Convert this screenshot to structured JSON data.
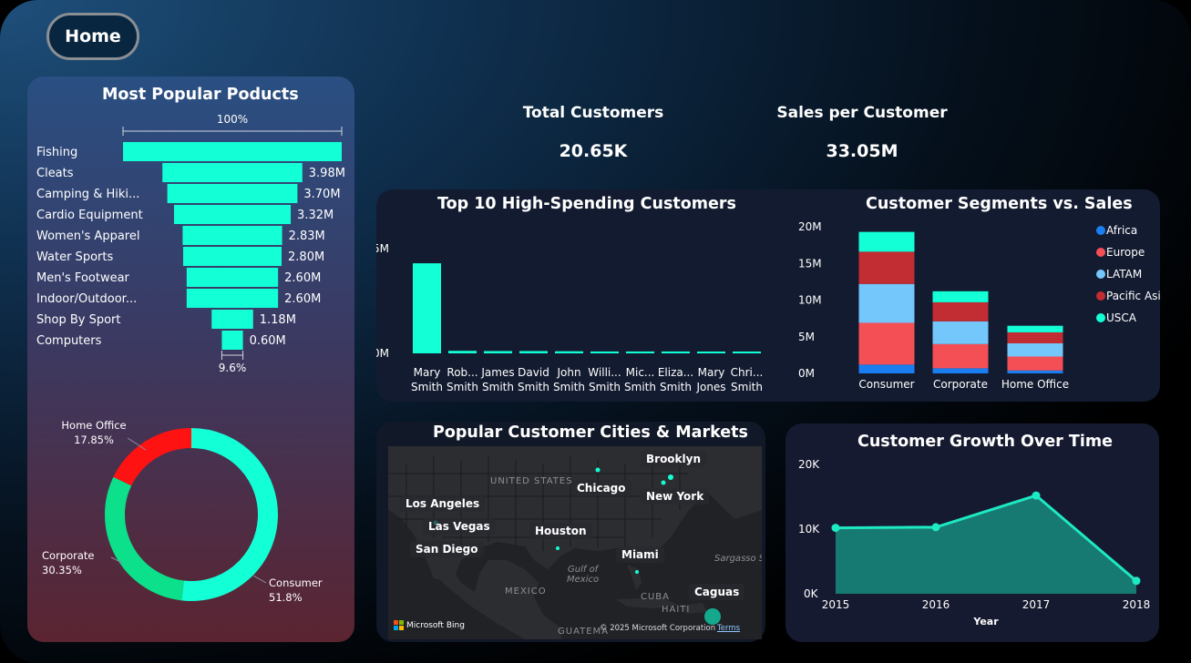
{
  "nav": {
    "home_label": "Home"
  },
  "products": {
    "title": "Most Popular Poducts",
    "top_pct": "100%",
    "bottom_pct": "9.6%",
    "items": [
      {
        "label": "Fishing",
        "value_label": "",
        "value": 6.22
      },
      {
        "label": "Cleats",
        "value_label": "3.98M",
        "value": 3.98
      },
      {
        "label": "Camping & Hiki...",
        "value_label": "3.70M",
        "value": 3.7
      },
      {
        "label": "Cardio Equipment",
        "value_label": "3.32M",
        "value": 3.32
      },
      {
        "label": "Women's Apparel",
        "value_label": "2.83M",
        "value": 2.83
      },
      {
        "label": "Water Sports",
        "value_label": "2.80M",
        "value": 2.8
      },
      {
        "label": "Men's Footwear",
        "value_label": "2.60M",
        "value": 2.6
      },
      {
        "label": "Indoor/Outdoor...",
        "value_label": "2.60M",
        "value": 2.6
      },
      {
        "label": "Shop By Sport",
        "value_label": "1.18M",
        "value": 1.18
      },
      {
        "label": "Computers",
        "value_label": "0.60M",
        "value": 0.6
      }
    ],
    "bar_color": "#13ffd6"
  },
  "donut": {
    "segments": [
      {
        "name": "Consumer",
        "pct_label": "51.8%",
        "value": 51.8,
        "color": "#13ffd6"
      },
      {
        "name": "Corporate",
        "pct_label": "30.35%",
        "value": 30.35,
        "color": "#0ce08a"
      },
      {
        "name": "Home Office",
        "pct_label": "17.85%",
        "value": 17.85,
        "color": "#ff1212"
      }
    ]
  },
  "kpis": {
    "total_customers_title": "Total Customers",
    "total_customers_value": "20.65K",
    "sales_per_customer_title": "Sales per Customer",
    "sales_per_customer_value": "33.05M"
  },
  "top_customers": {
    "title": "Top 10 High-Spending Customers",
    "y_ticks": [
      "5M",
      "0M"
    ],
    "names": [
      [
        "Mary",
        "Smith"
      ],
      [
        "Rob...",
        "Smith"
      ],
      [
        "James",
        "Smith"
      ],
      [
        "David",
        "Smith"
      ],
      [
        "John",
        "Smith"
      ],
      [
        "Willi...",
        "Smith"
      ],
      [
        "Mic...",
        "Smith"
      ],
      [
        "Eliza...",
        "Smith"
      ],
      [
        "Mary",
        "Jones"
      ],
      [
        "Chri...",
        "Smith"
      ]
    ]
  },
  "segments_chart": {
    "title": "Customer Segments vs. Sales",
    "y_ticks": [
      "20M",
      "15M",
      "10M",
      "5M",
      "0M"
    ],
    "legend": [
      {
        "name": "Africa",
        "color": "#1a7ef0"
      },
      {
        "name": "Europe",
        "color": "#f54f56"
      },
      {
        "name": "LATAM",
        "color": "#74c7fb"
      },
      {
        "name": "Pacific Asia",
        "color": "#c22c33"
      },
      {
        "name": "USCA",
        "color": "#13ffd6"
      }
    ]
  },
  "map": {
    "title": "Popular Customer Cities & Markets",
    "cities": [
      "Brooklyn",
      "Los Angeles",
      "Chicago",
      "New York",
      "Las Vegas",
      "Houston",
      "San Diego",
      "Miami",
      "Caguas"
    ],
    "geo_labels": [
      "UNITED STATES",
      "MEXICO",
      "Gulf of",
      "Mexico",
      "CUBA",
      "HAITI",
      "Sargasso Se",
      "GUATEMA"
    ],
    "bing_label": "Microsoft Bing",
    "copyright": "© 2025 Microsoft Corporation",
    "terms": "Terms"
  },
  "growth": {
    "title": "Customer Growth Over Time",
    "y_ticks": [
      "20K",
      "10K",
      "0K"
    ],
    "xlabel": "Year",
    "line_color": "#1de9c3",
    "fill_color": "#177a72"
  },
  "chart_data": [
    {
      "type": "bar",
      "title": "Top 10 High-Spending Customers",
      "categories": [
        "Mary Smith",
        "Rob... Smith",
        "James Smith",
        "David Smith",
        "John Smith",
        "Willi... Smith",
        "Mic... Smith",
        "Eliza... Smith",
        "Mary Jones",
        "Chri... Smith"
      ],
      "values": [
        4.3,
        0.12,
        0.11,
        0.11,
        0.1,
        0.09,
        0.09,
        0.09,
        0.08,
        0.08
      ],
      "ylim": [
        0,
        5
      ],
      "color": "#13ffd6"
    },
    {
      "type": "bar",
      "title": "Customer Segments vs. Sales",
      "categories": [
        "Consumer",
        "Corporate",
        "Home Office"
      ],
      "stacked": true,
      "series": [
        {
          "name": "Africa",
          "values": [
            1.2,
            0.7,
            0.4
          ]
        },
        {
          "name": "Europe",
          "values": [
            5.7,
            3.3,
            1.9
          ]
        },
        {
          "name": "LATAM",
          "values": [
            5.3,
            3.1,
            1.8
          ]
        },
        {
          "name": "Pacific Asia",
          "values": [
            4.4,
            2.6,
            1.5
          ]
        },
        {
          "name": "USCA",
          "values": [
            2.7,
            1.5,
            0.9
          ]
        }
      ],
      "ylim": [
        0,
        20
      ]
    },
    {
      "type": "area",
      "title": "Customer Growth Over Time",
      "x": [
        "2015",
        "2016",
        "2017",
        "2018"
      ],
      "values": [
        10.2,
        10.3,
        15.2,
        2.0
      ],
      "ylim": [
        0,
        20
      ],
      "xlabel": "Year"
    }
  ]
}
